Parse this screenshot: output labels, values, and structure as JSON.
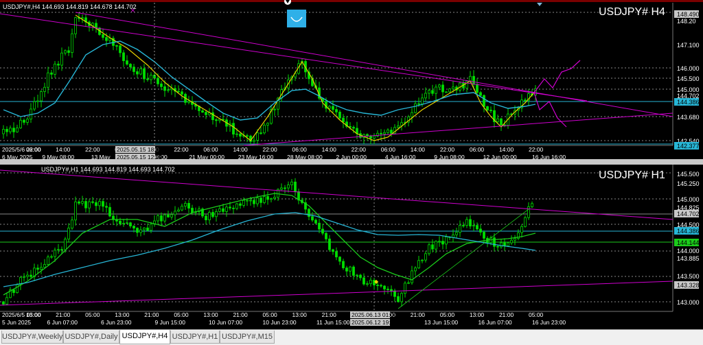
{
  "colors": {
    "background": "#000000",
    "candle": "#00dd00",
    "ma_fast": "#e8d000",
    "ma_slow": "#27b6d6",
    "trend": "#d000d0",
    "grid": "#8a8a8a"
  },
  "top_marker_icon": "down-triangle-icon",
  "h4": {
    "header": "USDJPY#,H4  144.693 144.819 144.678 144.702",
    "symbol_label": "USDJPY# H4",
    "indicator_icon": "smile-curve-icon",
    "x_marker": "×",
    "price_labels": [
      "148.490",
      "148.20",
      "147.100",
      "146.000",
      "145.500",
      "145.000",
      "144.702",
      "144.386",
      "143.680",
      "142.540",
      "142.377"
    ],
    "time_row1": [
      "2025/5/6 22:00",
      "06:00",
      "14:00",
      "22:00",
      "06:00",
      "14:00",
      "22:00",
      "06:00",
      "14:00",
      "22:00",
      "06:00",
      "14:00",
      "22:00",
      "06:00",
      "14:00",
      "22:00",
      "06:00",
      "14:00",
      "22:00"
    ],
    "time_row2": [
      "6 May 2025",
      "9 May 08:00",
      "13 May",
      "May 08:00",
      "21 May 00:00",
      "23 May 16:00",
      "28 May 08:00",
      "2 Jun 00:00",
      "4 Jun 16:00",
      "9 Jun 08:00",
      "12 Jun 00:00",
      "16 Jun 16:00"
    ],
    "time_markers": [
      "2025.05.15 18:00",
      "2025.05.15 12:00"
    ]
  },
  "h1": {
    "header": "USDJPY#,H1  144.693 144.819 144.693 144.702",
    "symbol_label": "USDJPY# H1",
    "price_labels": [
      "145.500",
      "145.250",
      "145.000",
      "144.825",
      "144.702",
      "144.500",
      "144.386",
      "144.144",
      "144.000",
      "143.885",
      "143.500",
      "143.328",
      "143.000"
    ],
    "time_row1": [
      "2025/6/5 05:00",
      "13:00",
      "21:00",
      "05:00",
      "13:00",
      "21:00",
      "05:00",
      "13:00",
      "21:00",
      "05:00",
      "13:00",
      "21:00",
      "05:00",
      "13:00",
      "21:00",
      "05:00",
      "13:00",
      "21:00",
      "05:00"
    ],
    "time_row2": [
      "5 Jun 2025",
      "6 Jun 07:00",
      "6 Jun 23:00",
      "9 Jun 15:00",
      "10 Jun 07:00",
      "10 Jun 23:00",
      "11 Jun 15:00",
      "12 Jun",
      "13 Jun 15:00",
      "16 Jun 07:00",
      "16 Jun 23:00"
    ],
    "time_markers": [
      "2025.06.13 01:00",
      "2025.06.12 19:00"
    ]
  },
  "tabs": [
    "USDJPY#,Weekly",
    "USDJPY#,Daily",
    "USDJPY#,H4",
    "USDJPY#,H1",
    "USDJPY#,M15"
  ],
  "active_tab": "USDJPY#,H4"
}
